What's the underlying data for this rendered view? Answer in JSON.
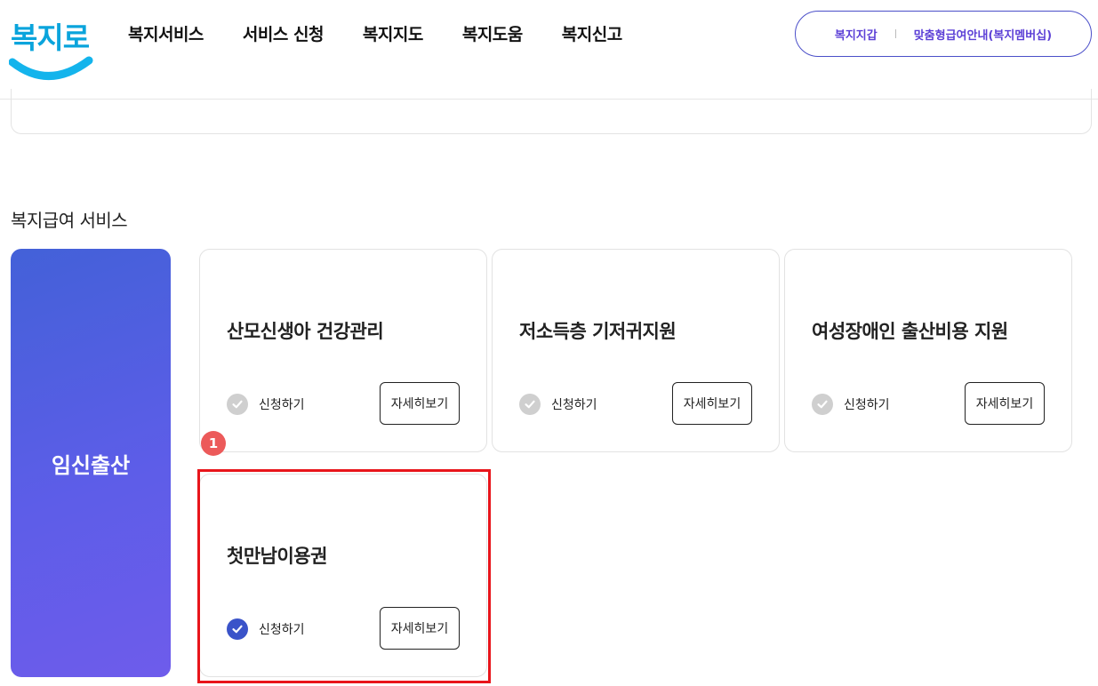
{
  "logo": {
    "text": "복지로",
    "colors": {
      "text": "#0aa4dc",
      "smile": "#14b4ec"
    }
  },
  "nav": {
    "items": [
      "복지서비스",
      "서비스 신청",
      "복지지도",
      "복지도움",
      "복지신고"
    ]
  },
  "header_links": {
    "wallet": "복지지갑",
    "membership": "맞춤형급여안내(복지멤버십)"
  },
  "section_title": "복지급여 서비스",
  "category": {
    "label": "임신출산"
  },
  "cards": [
    {
      "title": "산모신생아 건강관리",
      "apply_label": "신청하기",
      "detail_label": "자세히보기",
      "selected": false
    },
    {
      "title": "저소득층 기저귀지원",
      "apply_label": "신청하기",
      "detail_label": "자세히보기",
      "selected": false
    },
    {
      "title": "여성장애인 출산비용 지원",
      "apply_label": "신청하기",
      "detail_label": "자세히보기",
      "selected": false
    },
    {
      "title": "첫만남이용권",
      "apply_label": "신청하기",
      "detail_label": "자세히보기",
      "selected": true
    }
  ],
  "annotation": {
    "badge": "1"
  },
  "colors": {
    "accent": "#3a53c9",
    "highlight": "#e8151b",
    "badge": "#ec5a5a",
    "category_gradient": [
      "#4361d8",
      "#6e5ceb"
    ]
  }
}
